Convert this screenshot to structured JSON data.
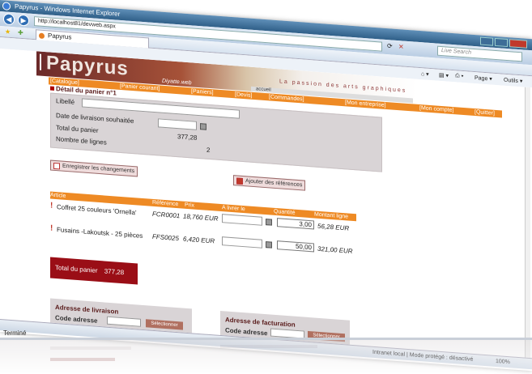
{
  "window": {
    "title": "Papyrus - Windows Internet Explorer",
    "url": "http://localhost81/devweb.aspx",
    "search_placeholder": "Live Search",
    "tab_label": "Papyrus",
    "cmd_page": "Page ▾",
    "cmd_tools": "Outils ▾"
  },
  "site": {
    "logo": "Papyrus",
    "tagline": "La passion des arts graphiques",
    "sub_logo": "Diyatte.web",
    "home_label": "accueil"
  },
  "menu": [
    "[Catalogue]",
    "[Panier courant]",
    "[Paniers]",
    "[Devis]",
    "[Commandes]",
    "[Mon entreprise]",
    "[Mon compte]",
    "[Quitter]"
  ],
  "detail": {
    "title": "Détail du panier n°1",
    "libelle_label": "Libellé",
    "libelle_value": "",
    "delivery_label": "Date de livraison souhaitée",
    "delivery_value": "",
    "total_label": "Total du panier",
    "total_value": "377,28",
    "lines_label": "Nombre de lignes",
    "lines_value": "2"
  },
  "actions": {
    "save": "Enregistrer les changements",
    "add_refs": "Ajouter des références"
  },
  "table": {
    "headers": [
      "Article",
      "Référence",
      "Prix",
      "A livrer le",
      "Quantité",
      "Montant ligne"
    ],
    "rows": [
      {
        "article": "Coffret 25 couleurs 'Ornella'",
        "reference": "FCR0001",
        "prix": "18,760 EUR",
        "livrer": "",
        "quantite": "3,00",
        "montant": "56,28 EUR"
      },
      {
        "article": "Fusains -Lakoutsk - 25 pièces",
        "reference": "FFS0025",
        "prix": "6,420 EUR",
        "livrer": "",
        "quantite": "50,00",
        "montant": "321,00 EUR"
      }
    ]
  },
  "total_box": {
    "label": "Total du panier",
    "value": "377,28"
  },
  "addresses": {
    "delivery_title": "Adresse de livraison",
    "billing_title": "Adresse de facturation",
    "code_label": "Code adresse",
    "select_label": "Sélectionner"
  },
  "status": {
    "done": "Terminé",
    "zone": "Intranet local | Mode protégé : désactivé",
    "zoom": "100%"
  }
}
